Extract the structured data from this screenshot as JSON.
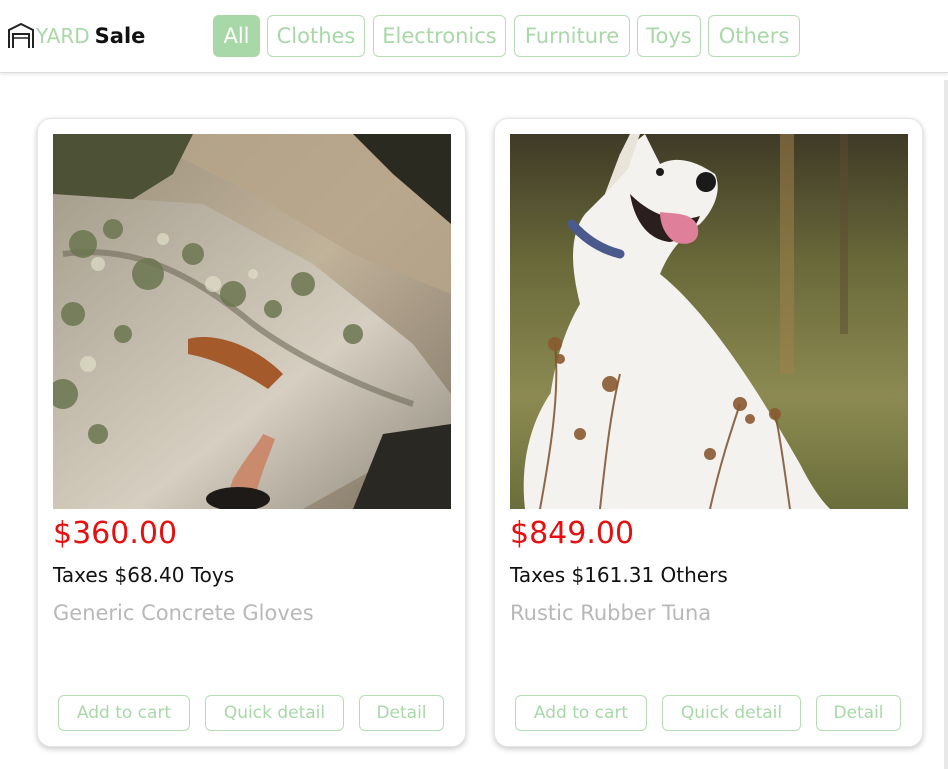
{
  "header": {
    "logo_brand": "YARD",
    "logo_suffix": "Sale",
    "icon": "garage-icon"
  },
  "filters": [
    {
      "label": "All",
      "active": true
    },
    {
      "label": "Clothes",
      "active": false
    },
    {
      "label": "Electronics",
      "active": false
    },
    {
      "label": "Furniture",
      "active": false
    },
    {
      "label": "Toys",
      "active": false
    },
    {
      "label": "Others",
      "active": false
    }
  ],
  "products": [
    {
      "price": "$360.00",
      "taxes_line": "Taxes $68.40 Toys",
      "name": "Generic Concrete Gloves",
      "image": "rock-climber-photo",
      "actions": {
        "add": "Add to cart",
        "quick": "Quick detail",
        "detail": "Detail"
      }
    },
    {
      "price": "$849.00",
      "taxes_line": "Taxes $161.31 Others",
      "name": "Rustic Rubber Tuna",
      "image": "white-dog-photo",
      "actions": {
        "add": "Add to cart",
        "quick": "Quick detail",
        "detail": "Detail"
      }
    }
  ],
  "colors": {
    "accent_green": "#a8d8a8",
    "price_red": "#e61010",
    "muted_gray": "#b8b8b8"
  }
}
